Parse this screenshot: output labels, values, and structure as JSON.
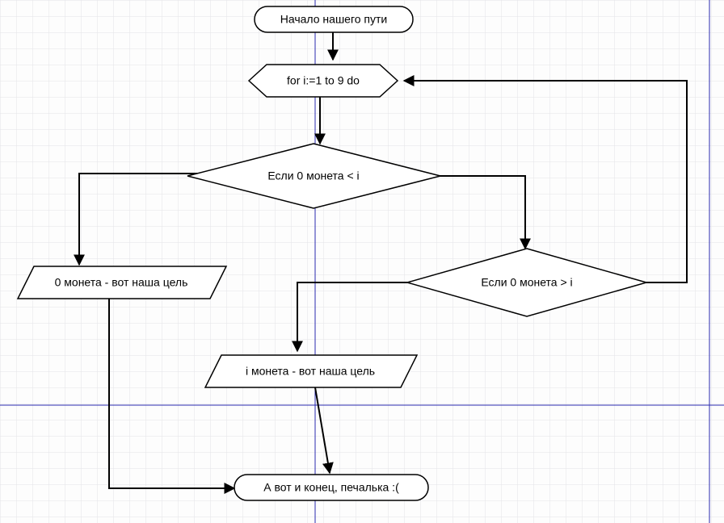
{
  "flowchart": {
    "nodes": {
      "start": {
        "label": "Начало нашего пути",
        "type": "terminator"
      },
      "loop": {
        "label": "for i:=1 to 9 do",
        "type": "loop"
      },
      "cond1": {
        "label": "Если 0 монета < i",
        "type": "decision"
      },
      "out1": {
        "label": "0 монета - вот наша цель",
        "type": "io"
      },
      "cond2": {
        "label": "Если 0 монета > i",
        "type": "decision"
      },
      "out2": {
        "label": "i монета - вот наша цель",
        "type": "io"
      },
      "end": {
        "label": "А вот и конец, печалька :(",
        "type": "terminator"
      }
    },
    "edges": [
      {
        "from": "start",
        "to": "loop"
      },
      {
        "from": "loop",
        "to": "cond1"
      },
      {
        "from": "cond1",
        "to": "out1",
        "branch": "left"
      },
      {
        "from": "cond1",
        "to": "cond2",
        "branch": "right"
      },
      {
        "from": "cond2",
        "to": "out2",
        "branch": "left"
      },
      {
        "from": "cond2",
        "to": "loop",
        "branch": "right"
      },
      {
        "from": "out1",
        "to": "end"
      },
      {
        "from": "out2",
        "to": "end"
      }
    ]
  }
}
